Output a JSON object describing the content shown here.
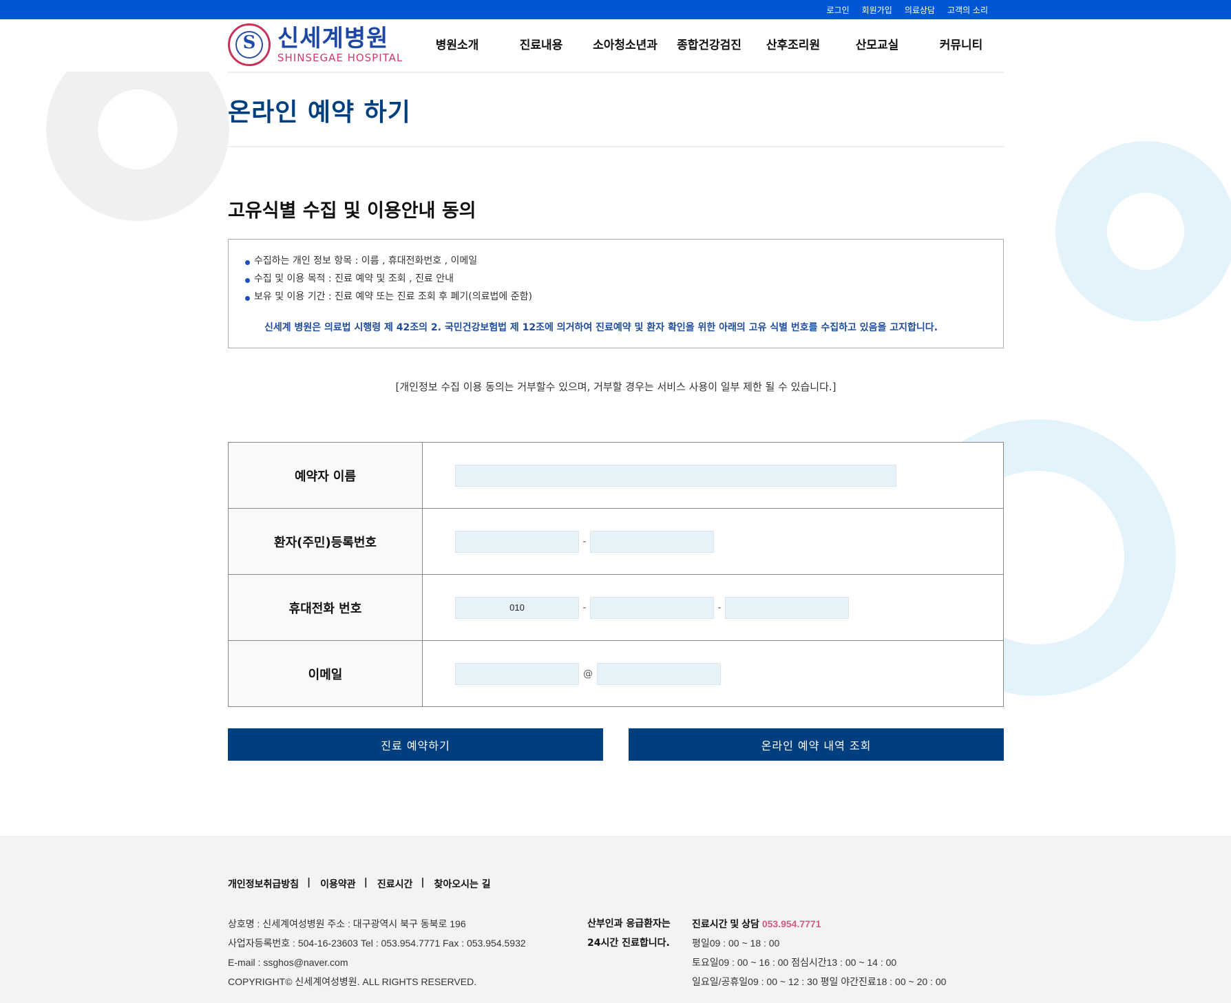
{
  "top_links": [
    "로그인",
    "회원가입",
    "의료상담",
    "고객의 소리"
  ],
  "logo": {
    "korean": "신세계병원",
    "english": "SHINSEGAE HOSPITAL",
    "mark": "S"
  },
  "nav": [
    "병원소개",
    "진료내용",
    "소아청소년과",
    "종합건강검진",
    "산후조리원",
    "산모교실",
    "커뮤니티"
  ],
  "page_title": "온라인 예약 하기",
  "section_title": "고유식별 수집 및 이용안내 동의",
  "notice": {
    "items": [
      "수집하는 개인 정보 항목 : 이름 , 휴대전화번호 , 이메일",
      "수집 및 이용 목적 : 진료 예약 및 조회 , 진료 안내",
      "보유 및 이용 기간 : 진료 예약 또는 진료 조회 후 폐기(의료법에 준함)"
    ],
    "legal": "신세계 병원은 의료법 시행령 제 42조의 2. 국민건강보험법 제 12조에 의거하여 진료예약 및 환자 확인을 위한 아래의 고유 식별 번호를 수집하고 있음을 고지합니다."
  },
  "refuse_notice": "[개인정보 수집 이용 동의는 거부할수 있으며, 거부할 경우는 서비스 사용이 일부 제한 될 수 있습니다.]",
  "form": {
    "name_label": "예약자 이름",
    "reg_label": "환자(주민)등록번호",
    "phone_label": "휴대전화 번호",
    "phone_prefix": "010",
    "email_label": "이메일",
    "dash": "-",
    "at": "@"
  },
  "buttons": {
    "reserve": "진료 예약하기",
    "lookup": "온라인 예약 내역 조회"
  },
  "footer": {
    "links": [
      "개인정보취급방침",
      "이용약관",
      "진료시간",
      "찾아오시는 길"
    ],
    "separator": "|",
    "info": [
      "상호명 : 신세계여성병원 주소 : 대구광역시 북구 동북로 196",
      "사업자등록번호 : 504-16-23603 Tel : 053.954.7771 Fax : 053.954.5932",
      "E-mail : ssghos@naver.com",
      "COPYRIGHT© 신세계여성병원. ALL RIGHTS RESERVED."
    ],
    "emergency": [
      "산부인과 응급환자는",
      "24시간 진료합니다."
    ],
    "hours_title": "진료시간 및 상담",
    "hours_phone": "053.954.7771",
    "hours": [
      "평일09 : 00 ~ 18 : 00",
      "토요일09 : 00 ~ 16 : 00 점심시간13 : 00 ~ 14 : 00",
      "일요일/공휴일09 : 00 ~ 12 : 30 평일 야간진료18 : 00 ~ 20 : 00"
    ]
  },
  "colors": {
    "topbar": "#0057d4",
    "title": "#003f7f",
    "button": "#003f7f",
    "input": "#e6f2f8",
    "accent_pink": "#d05a86"
  }
}
